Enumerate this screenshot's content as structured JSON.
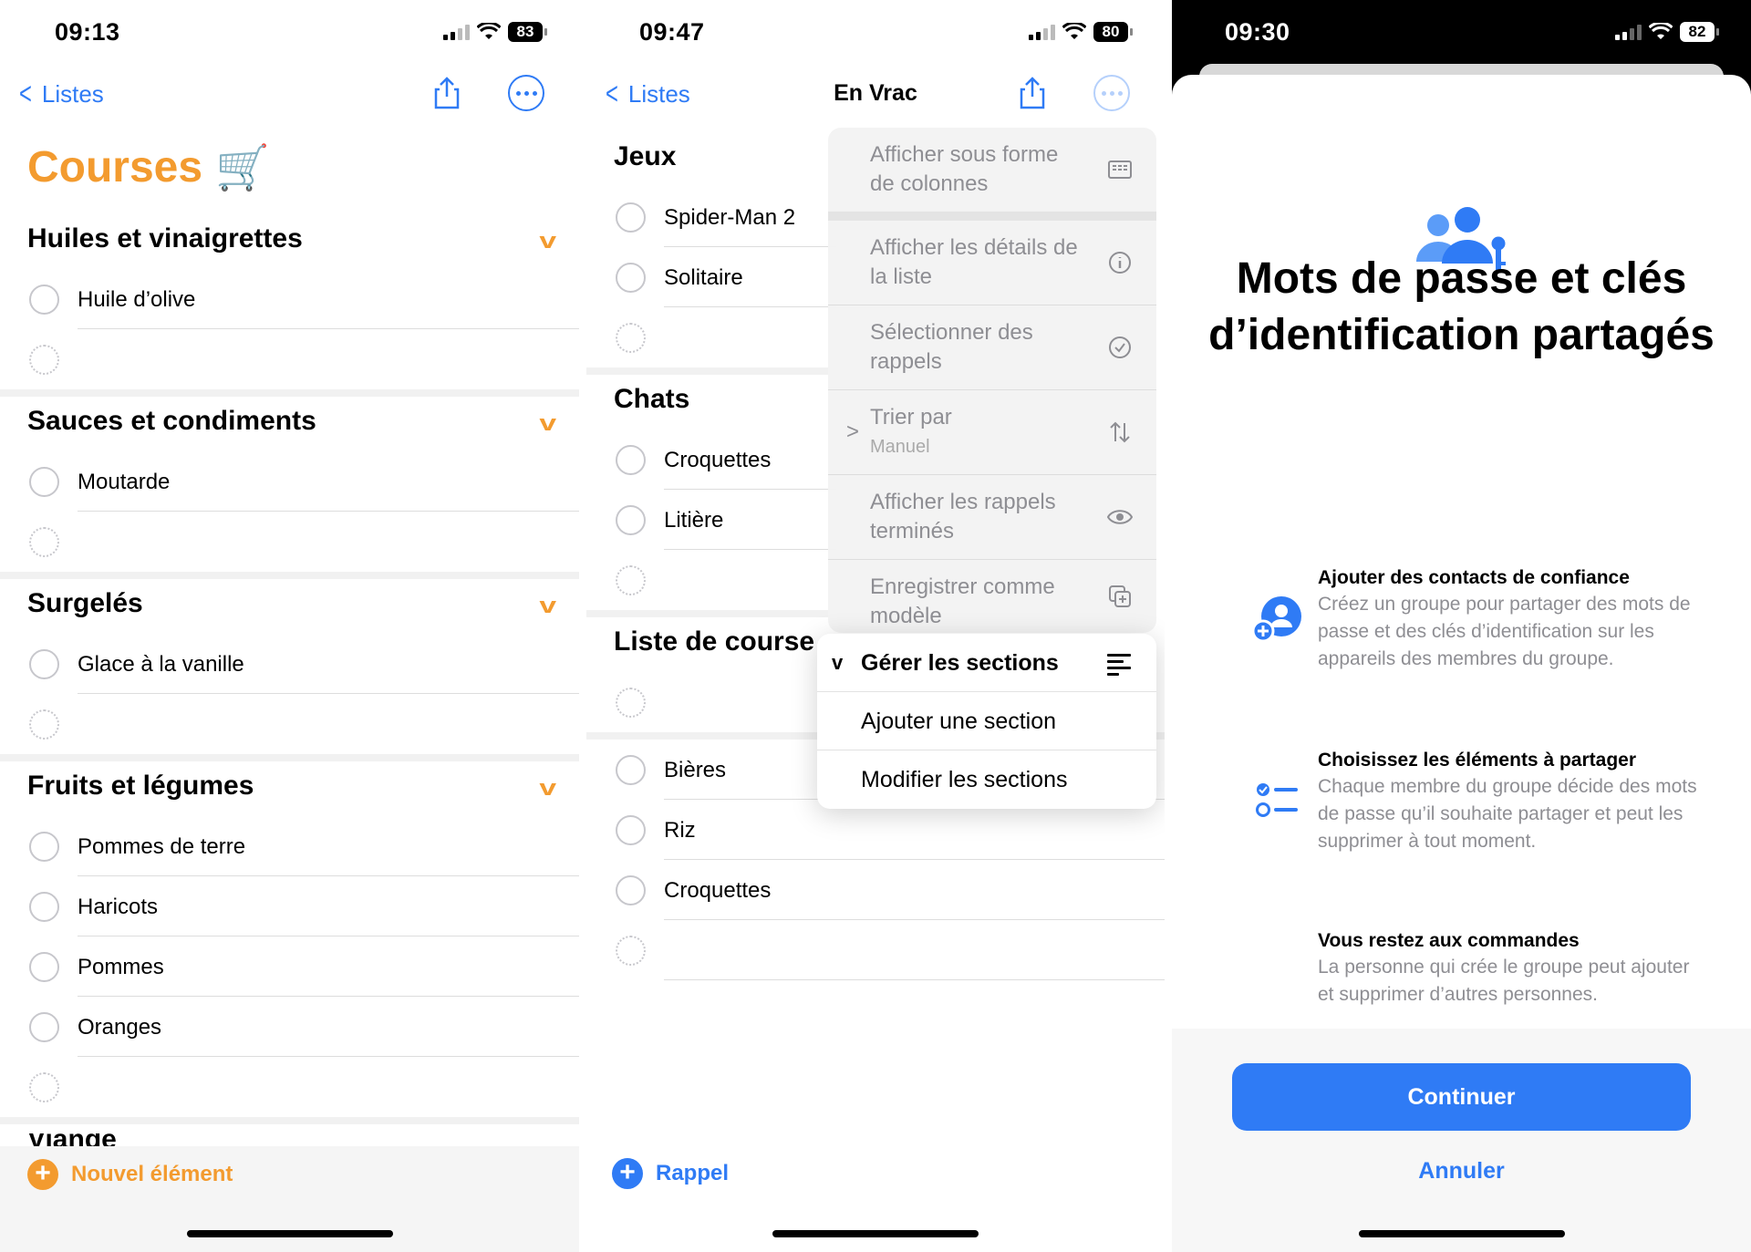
{
  "colors": {
    "accent_orange": "#f39b2f",
    "accent_blue": "#2f7bf5"
  },
  "panel1": {
    "time": "09:13",
    "battery": "83",
    "back_label": "Listes",
    "title": "Courses",
    "title_emoji": "🛒",
    "sections": [
      {
        "name": "Huiles et vinaigrettes",
        "items": [
          "Huile d’olive"
        ]
      },
      {
        "name": "Sauces et condiments",
        "items": [
          "Moutarde"
        ]
      },
      {
        "name": "Surgelés",
        "items": [
          "Glace à la vanille"
        ]
      },
      {
        "name": "Fruits et légumes",
        "items": [
          "Pommes de terre",
          "Haricots",
          "Pommes",
          "Oranges"
        ]
      }
    ],
    "partial_section": "Viande",
    "new_item_label": "Nouvel élément"
  },
  "panel2": {
    "time": "09:47",
    "battery": "80",
    "back_label": "Listes",
    "title": "En Vrac",
    "sections": [
      {
        "name": "Jeux",
        "items": [
          "Spider-Man 2",
          "Solitaire"
        ]
      },
      {
        "name": "Chats",
        "items": [
          "Croquettes",
          "Litière"
        ]
      },
      {
        "name": "Liste de course",
        "items": []
      }
    ],
    "unsectioned_items": [
      "Bières",
      "Riz",
      "Croquettes"
    ],
    "menu": [
      {
        "label": "Afficher sous forme de colonnes",
        "icon": "columns-icon"
      },
      {
        "label": "Afficher les détails de la liste",
        "icon": "info-icon"
      },
      {
        "label": "Sélectionner des rappels",
        "icon": "checkmark-circle-icon"
      },
      {
        "label": "Trier par",
        "sub": "Manuel",
        "icon": "sort-icon"
      },
      {
        "label": "Afficher les rappels terminés",
        "icon": "eye-icon"
      },
      {
        "label": "Enregistrer comme modèle",
        "icon": "duplicate-icon"
      }
    ],
    "submenu": {
      "header": "Gérer les sections",
      "items": [
        "Ajouter une section",
        "Modifier les sections"
      ]
    },
    "new_item_label": "Rappel"
  },
  "panel3": {
    "time": "09:30",
    "battery": "82",
    "title": "Mots de passe et clés d’identification partagés",
    "features": [
      {
        "title": "Ajouter des contacts de confiance",
        "body": "Créez un groupe pour partager des mots de passe et des clés d’identification sur les appareils des membres du groupe.",
        "icon": "add-contact-icon"
      },
      {
        "title": "Choisissez les éléments à partager",
        "body": "Chaque membre du groupe décide des mots de passe qu’il souhaite partager et peut les supprimer à tout moment.",
        "icon": "checklist-icon"
      },
      {
        "title": "Vous restez aux commandes",
        "body": "La personne qui crée le groupe peut ajouter et supprimer d’autres personnes.",
        "icon": "toggles-icon"
      }
    ],
    "continue_label": "Continuer",
    "cancel_label": "Annuler"
  }
}
